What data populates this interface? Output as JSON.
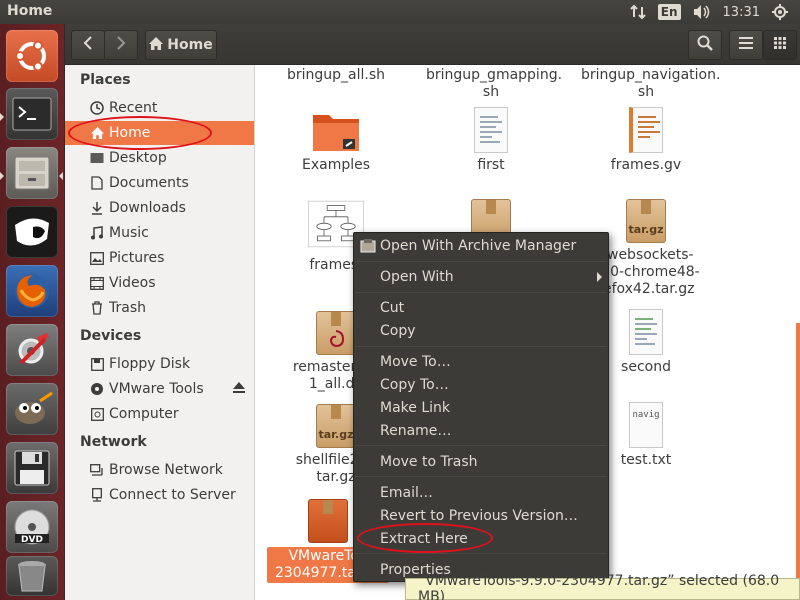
{
  "top_panel": {
    "title": "Home",
    "lang": "En",
    "clock": "13:31"
  },
  "toolbar": {
    "path_label": "Home",
    "icons": [
      "back-icon",
      "forward-icon",
      "home-icon",
      "search-icon",
      "list-view-icon",
      "grid-view-icon"
    ]
  },
  "sidebar": {
    "places_heading": "Places",
    "places": [
      {
        "label": "Recent",
        "icon": "clock-icon"
      },
      {
        "label": "Home",
        "icon": "home-icon"
      },
      {
        "label": "Desktop",
        "icon": "desktop-icon"
      },
      {
        "label": "Documents",
        "icon": "document-icon"
      },
      {
        "label": "Downloads",
        "icon": "download-icon"
      },
      {
        "label": "Music",
        "icon": "music-icon"
      },
      {
        "label": "Pictures",
        "icon": "pictures-icon"
      },
      {
        "label": "Videos",
        "icon": "videos-icon"
      },
      {
        "label": "Trash",
        "icon": "trash-icon"
      }
    ],
    "devices_heading": "Devices",
    "devices": [
      {
        "label": "Floppy Disk",
        "icon": "floppy-icon"
      },
      {
        "label": "VMware Tools",
        "icon": "disc-icon"
      },
      {
        "label": "Computer",
        "icon": "computer-icon"
      }
    ],
    "network_heading": "Network",
    "network": [
      {
        "label": "Browse Network",
        "icon": "network-icon"
      },
      {
        "label": "Connect to Server",
        "icon": "server-icon"
      }
    ]
  },
  "files": [
    {
      "name": "bringup_all.sh"
    },
    {
      "name": "bringup_gmapping.\nsh"
    },
    {
      "name": "bringup_navigation.\nsh"
    },
    {
      "name": "Examples"
    },
    {
      "name": "first"
    },
    {
      "name": "frames.gv"
    },
    {
      "name": "frames."
    },
    {
      "name": "owebsockets-\n.6.0-chrome48-\nrefox42.tar.gz",
      "badge": "tar.gz"
    },
    {
      "name": "remastersys\n1_all.de"
    },
    {
      "name": "second"
    },
    {
      "name": "shellfile201\ntar.gz",
      "badge": "tar.gz"
    },
    {
      "name": "test.txt",
      "badge": "navig"
    },
    {
      "name": "VMwareToo\n2304977.tar.gz"
    }
  ],
  "context_menu": {
    "items": [
      "Open With Archive Manager",
      "Open With",
      "Cut",
      "Copy",
      "Move To…",
      "Copy To…",
      "Make Link",
      "Rename…",
      "Move to Trash",
      "Email…",
      "Revert to Previous Version…",
      "Extract Here",
      "Properties"
    ]
  },
  "status_bar": {
    "text": "“VMwareTools-9.9.0-2304977.tar.gz” selected  (68.0 MB)"
  },
  "colors": {
    "accent": "#f07746",
    "annotation": "#e0111a",
    "menu_bg": "#3c3b37",
    "launcher_bg": "#6d2427"
  }
}
